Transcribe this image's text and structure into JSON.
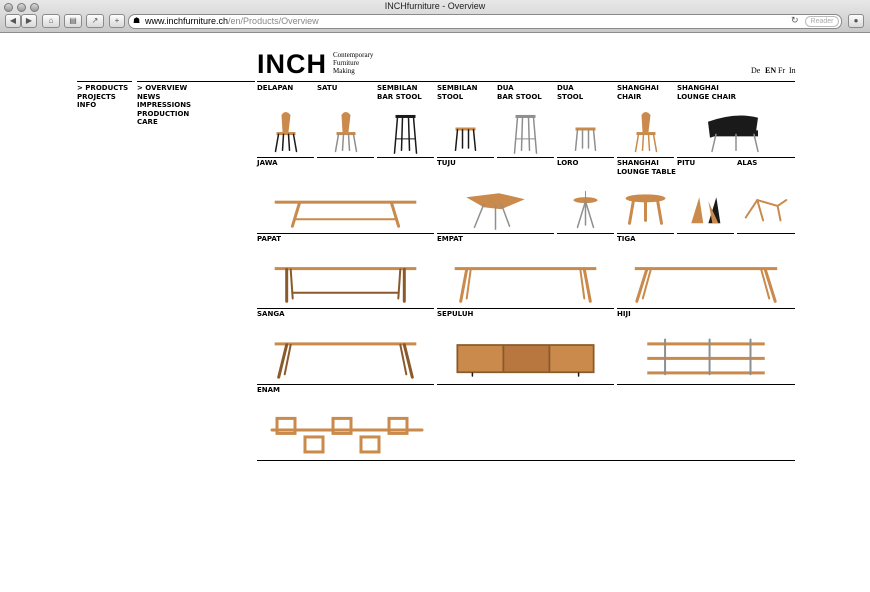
{
  "browser": {
    "window_title": "INCHfurniture - Overview",
    "url_host": "www.inchfurniture.ch",
    "url_path": "/en/Products/Overview",
    "reader_label": "Reader",
    "plus_label": "+"
  },
  "site": {
    "logo": "INCH",
    "tagline": [
      "Contemporary",
      "Furniture",
      "Making"
    ],
    "languages": [
      {
        "label": "De",
        "active": false
      },
      {
        "label": "EN",
        "active": true
      },
      {
        "label": "Fr",
        "active": false
      },
      {
        "label": "In",
        "active": false
      }
    ],
    "main_nav": [
      "> PRODUCTS",
      "PROJECTS",
      "INFO"
    ],
    "sub_nav": [
      "> OVERVIEW",
      "NEWS",
      "IMPRESSIONS",
      "PRODUCTION",
      "CARE"
    ]
  },
  "products": [
    {
      "name": "DELAPAN",
      "icon": "chair-icon"
    },
    {
      "name": "SATU",
      "icon": "chair-icon"
    },
    {
      "name": "SEMBILAN\nBAR STOOL",
      "icon": "bar-stool-icon"
    },
    {
      "name": "SEMBILAN\nSTOOL",
      "icon": "stool-icon"
    },
    {
      "name": "DUA\nBAR STOOL",
      "icon": "bar-stool-icon"
    },
    {
      "name": "DUA\nSTOOL",
      "icon": "stool-icon"
    },
    {
      "name": "SHANGHAI\nCHAIR",
      "icon": "chair-icon"
    },
    {
      "name": "SHANGHAI\nLOUNGE CHAIR",
      "icon": "lounge-chair-icon"
    },
    {
      "name": "JAWA",
      "icon": "bench-icon"
    },
    {
      "name": "TUJU",
      "icon": "side-table-icon"
    },
    {
      "name": "LORO",
      "icon": "round-table-icon"
    },
    {
      "name": "SHANGHAI\nLOUNGE TABLE",
      "icon": "lounge-table-icon"
    },
    {
      "name": "PITU",
      "icon": "bookend-icon"
    },
    {
      "name": "ALAS",
      "icon": "trestle-icon"
    },
    {
      "name": "PAPAT",
      "icon": "table-icon"
    },
    {
      "name": "EMPAT",
      "icon": "table-icon"
    },
    {
      "name": "TIGA",
      "icon": "table-icon"
    },
    {
      "name": "SANGA",
      "icon": "table-icon"
    },
    {
      "name": "SEPULUH",
      "icon": "sideboard-icon"
    },
    {
      "name": "HIJI",
      "icon": "shelf-icon"
    },
    {
      "name": "ENAM",
      "icon": "wall-shelf-icon"
    }
  ],
  "colors": {
    "wood": "#c98a4b",
    "wood_dark": "#8a5a2b",
    "metal": "#8f8f8f",
    "black": "#1a1a1a"
  }
}
